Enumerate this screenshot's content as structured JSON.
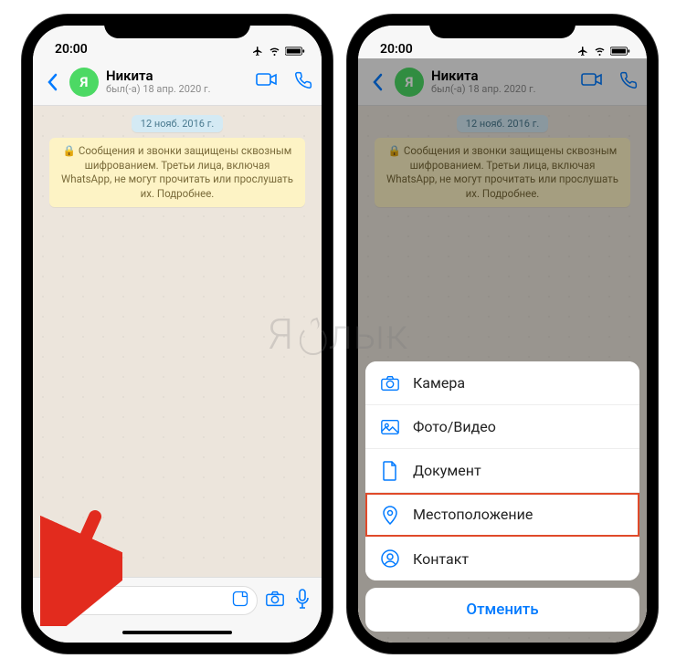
{
  "status": {
    "time": "20:00"
  },
  "chat": {
    "avatar_letter": "Я",
    "name": "Никита",
    "last_seen": "был(-а) 18 апр. 2020 г.",
    "date_chip": "12 нояб. 2016 г.",
    "encryption_notice": "🔒 Сообщения и звонки защищены сквозным шифрованием. Третьи лица, включая WhatsApp, не могут прочитать или прослушать их. Подробнее."
  },
  "sheet": {
    "items": [
      {
        "label": "Камера",
        "icon": "camera-icon"
      },
      {
        "label": "Фото/Видео",
        "icon": "photo-icon"
      },
      {
        "label": "Документ",
        "icon": "document-icon"
      },
      {
        "label": "Местоположение",
        "icon": "location-icon",
        "highlight": true
      },
      {
        "label": "Контакт",
        "icon": "contact-icon"
      }
    ],
    "cancel_label": "Отменить"
  },
  "watermark": {
    "prefix": "Я",
    "suffix": "лык"
  }
}
